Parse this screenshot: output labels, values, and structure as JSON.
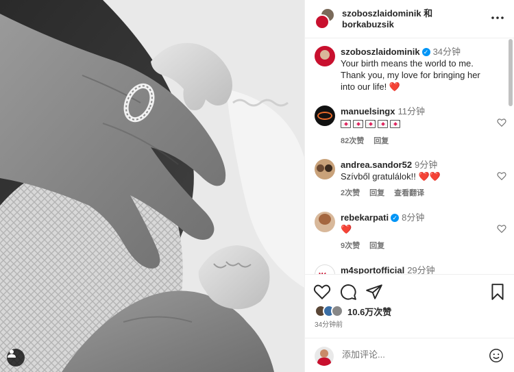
{
  "header": {
    "names": "szoboszlaidominik 和\nborkabuzsik"
  },
  "caption": {
    "username": "szoboszlaidominik",
    "time": "34分钟",
    "text": "Your birth means the world to me. Thank you, my love for bringing her into our life! ❤️"
  },
  "comments": [
    {
      "username": "manuelsingx",
      "time": "11分钟",
      "text": "",
      "likes": "82次赞",
      "reply": "回复",
      "translate": ""
    },
    {
      "username": "andrea.sandor52",
      "time": "9分钟",
      "text": "Szívből gratulálok!! ❤️❤️",
      "likes": "2次赞",
      "reply": "回复",
      "translate": "查看翻译"
    },
    {
      "username": "rebekarpati",
      "time": "8分钟",
      "text": "❤️",
      "likes": "9次赞",
      "reply": "回复",
      "translate": ""
    },
    {
      "username": "m4sportofficial",
      "time": "29分钟",
      "text": "",
      "likes": "",
      "reply": "",
      "translate": ""
    }
  ],
  "stats": {
    "likes": "10.6万次赞",
    "ago": "34分钟前"
  },
  "add_comment": {
    "placeholder": "添加评论..."
  },
  "colors": {
    "verified": "#0095f6",
    "heart": "#e0245e",
    "muted": "#737373"
  }
}
